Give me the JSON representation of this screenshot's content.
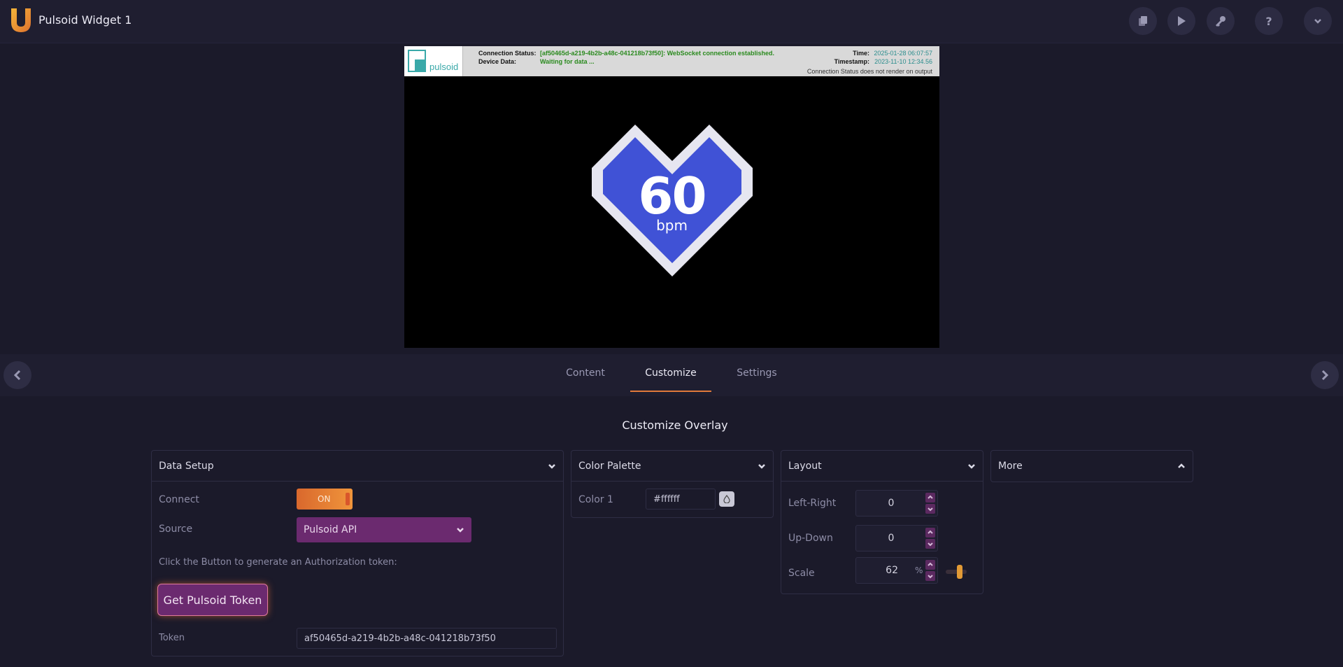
{
  "app": {
    "title": "Pulsoid Widget 1",
    "accent_color": "#e07a3a"
  },
  "toolbar": {
    "icons": [
      "copy-icon",
      "play-icon",
      "key-icon",
      "help-icon",
      "chevron-down-icon"
    ],
    "help_label": "?"
  },
  "preview": {
    "status": {
      "logo_text": "pulsoid",
      "connection_label": "Connection Status:",
      "connection_value": "[af50465d-a219-4b2b-a48c-041218b73f50]: WebSocket connection established.",
      "device_label": "Device Data:",
      "device_value": "Waiting for data ...",
      "time_label": "Time:",
      "time_value": "2025-01-28 06:07:57",
      "timestamp_label": "Timestamp:",
      "timestamp_value": "2023-11-10 12:34.56",
      "note": "Connection Status does not render on output"
    },
    "bpm_value": "60",
    "bpm_unit": "bpm",
    "heart_fill": "#4052d6",
    "heart_border": "#e6e6f0"
  },
  "tabs": [
    {
      "label": "Content",
      "active": false
    },
    {
      "label": "Customize",
      "active": true
    },
    {
      "label": "Settings",
      "active": false
    }
  ],
  "main": {
    "title": "Customize Overlay",
    "data_setup": {
      "title": "Data Setup",
      "connect_label": "Connect",
      "connect_state": "ON",
      "source_label": "Source",
      "source_value": "Pulsoid API",
      "instructions": "Click the Button to generate an Authorization token:",
      "token_button": "Get Pulsoid Token",
      "token_label": "Token",
      "token_value": "af50465d-a219-4b2b-a48c-041218b73f50"
    },
    "color_palette": {
      "title": "Color Palette",
      "color1_label": "Color 1",
      "color1_value": "#ffffff"
    },
    "layout": {
      "title": "Layout",
      "left_right_label": "Left-Right",
      "left_right_value": "0",
      "up_down_label": "Up-Down",
      "up_down_value": "0",
      "scale_label": "Scale",
      "scale_value": "62",
      "scale_unit": "%"
    },
    "more": {
      "title": "More"
    }
  }
}
